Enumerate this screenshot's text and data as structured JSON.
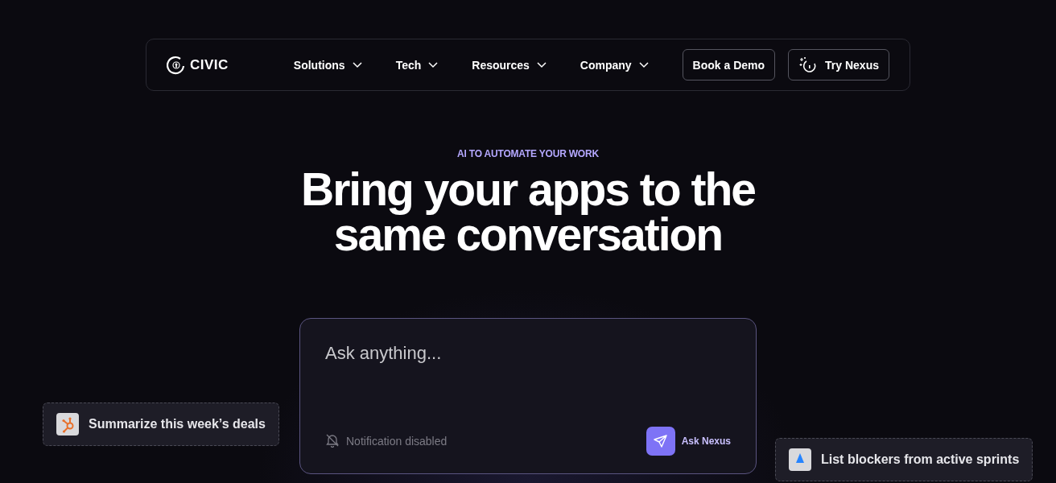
{
  "nav": {
    "logo": "CIVIC",
    "menu": [
      {
        "label": "Solutions"
      },
      {
        "label": "Tech"
      },
      {
        "label": "Resources"
      },
      {
        "label": "Company"
      }
    ],
    "buttons": [
      {
        "label": "Book a Demo",
        "kind": "plain"
      },
      {
        "label": "Try Nexus",
        "kind": "icon"
      }
    ]
  },
  "hero": {
    "eyebrow": "AI TO AUTOMATE YOUR WORK",
    "title_lines": [
      "Bring your apps to the",
      "same conversation"
    ]
  },
  "prompt": {
    "placeholder": "Ask anything...",
    "notification": "Notification disabled",
    "notifications_on": false,
    "submit": "Ask Nexus"
  },
  "chips": [
    {
      "text": "Summarize this week’s deals"
    },
    {
      "text": "List blockers from active sprints"
    }
  ]
}
